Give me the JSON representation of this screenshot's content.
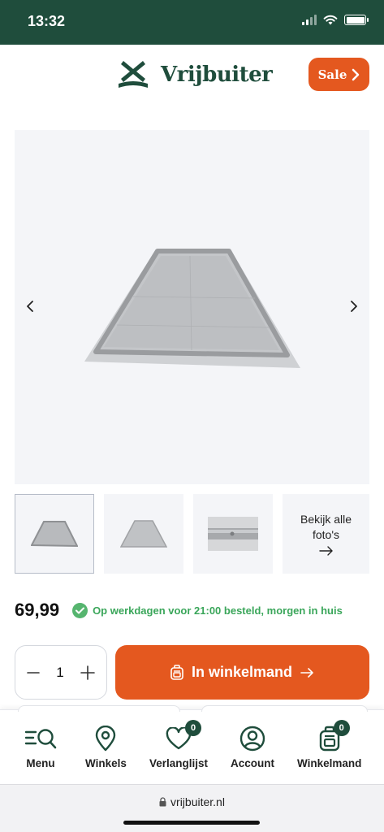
{
  "status": {
    "time": "13:32"
  },
  "header": {
    "brand": "Vrijbuiter",
    "sale_label": "Sale"
  },
  "gallery": {
    "prev_icon": "chevron-left-icon",
    "next_icon": "chevron-right-icon",
    "view_all": "Bekijk alle foto's"
  },
  "product": {
    "price": "69,99",
    "delivery": "Op werkdagen voor 21:00 besteld, morgen in huis",
    "quantity": "1",
    "add_to_cart": "In winkelmand"
  },
  "bottom_nav": {
    "items": [
      {
        "label": "Menu",
        "icon": "menu-search-icon"
      },
      {
        "label": "Winkels",
        "icon": "map-pin-icon"
      },
      {
        "label": "Verlanglijst",
        "icon": "heart-icon",
        "badge": "0"
      },
      {
        "label": "Account",
        "icon": "user-icon"
      },
      {
        "label": "Winkelmand",
        "icon": "backpack-icon",
        "badge": "0"
      }
    ]
  },
  "browser": {
    "url": "vrijbuiter.nl"
  },
  "colors": {
    "brand_green": "#1f4d3c",
    "accent_orange": "#e4581f",
    "success_green": "#3aa65a"
  }
}
